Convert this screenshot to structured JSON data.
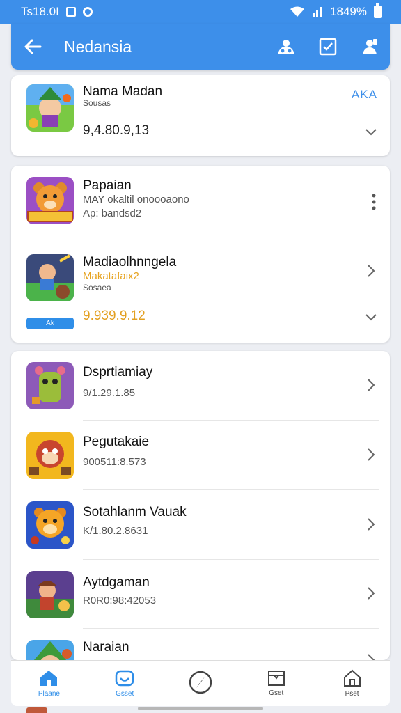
{
  "status": {
    "time": "Ts18.0I",
    "battery_text": "1849%"
  },
  "appbar": {
    "title": "Nedansia"
  },
  "featured": {
    "name": "Nama Madan",
    "sub": "Sousas",
    "price": "9,4.80.9,13",
    "tag": "AKA"
  },
  "group2": [
    {
      "name": "Papaian",
      "sub1": "MAY okaltil onoooaono",
      "sub2": "Ap: bandsd2"
    },
    {
      "name": "Madiaolhnngela",
      "sub1": "Makatafaix2",
      "sub2": "Sosaea",
      "badge": "Ak",
      "price": "9.939.9.12"
    }
  ],
  "group3": [
    {
      "name": "Dsprtiamiay",
      "sub": "9/1.29.1.85"
    },
    {
      "name": "Pegutakaie",
      "sub": "900511:8.573"
    },
    {
      "name": "Sotahlanm Vauak",
      "sub": "K/1.80.2.8631"
    },
    {
      "name": "Aytdgaman",
      "sub": "R0R0:98:42053"
    },
    {
      "name": "Naraian",
      "sub": ""
    }
  ],
  "nav": [
    {
      "label": "Plaane",
      "icon": "home-icon",
      "active": true
    },
    {
      "label": "Gsset",
      "icon": "controller-icon",
      "active": true
    },
    {
      "label": "",
      "icon": "compass-icon",
      "active": false
    },
    {
      "label": "Gset",
      "icon": "inbox-icon",
      "active": false
    },
    {
      "label": "Pset",
      "icon": "house-outline-icon",
      "active": false
    }
  ],
  "colors": {
    "primary": "#3d8fea",
    "accent_orange": "#e3a021",
    "background": "#eceef3"
  }
}
